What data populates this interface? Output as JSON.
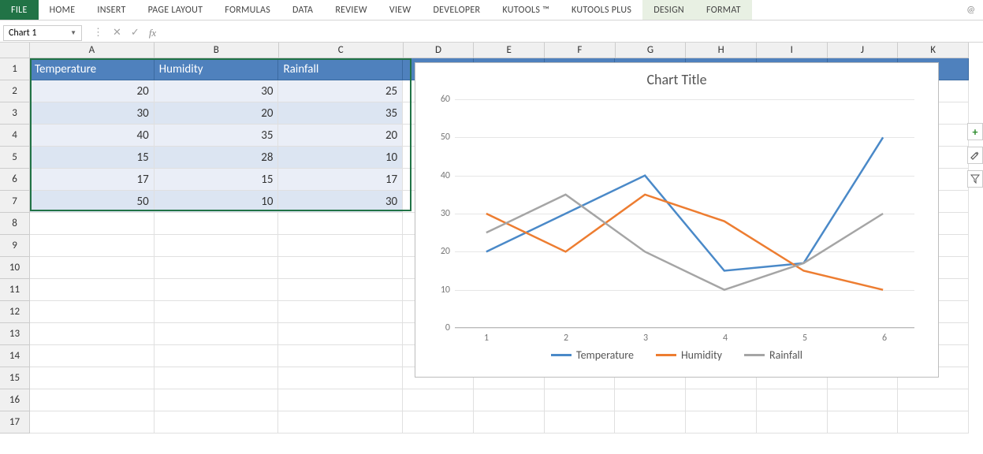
{
  "ribbon": {
    "tabs": [
      "FILE",
      "HOME",
      "INSERT",
      "PAGE LAYOUT",
      "FORMULAS",
      "DATA",
      "REVIEW",
      "VIEW",
      "DEVELOPER",
      "KUTOOLS ™",
      "KUTOOLS PLUS",
      "DESIGN",
      "FORMAT"
    ],
    "user": "@"
  },
  "namebox": "Chart 1",
  "columns": [
    "A",
    "B",
    "C",
    "D",
    "E",
    "F",
    "G",
    "H",
    "I",
    "J",
    "K"
  ],
  "rows": [
    "1",
    "2",
    "3",
    "4",
    "5",
    "6",
    "7",
    "8",
    "9",
    "10",
    "11",
    "12",
    "13",
    "14",
    "15",
    "16",
    "17"
  ],
  "table": {
    "headers": [
      "Temperature",
      "Humidity",
      "Rainfall"
    ],
    "data": [
      [
        20,
        30,
        25
      ],
      [
        30,
        20,
        35
      ],
      [
        40,
        35,
        20
      ],
      [
        15,
        28,
        10
      ],
      [
        17,
        15,
        17
      ],
      [
        50,
        10,
        30
      ]
    ]
  },
  "chart_data": {
    "type": "line",
    "title": "Chart Title",
    "categories": [
      1,
      2,
      3,
      4,
      5,
      6
    ],
    "series": [
      {
        "name": "Temperature",
        "values": [
          20,
          30,
          40,
          15,
          17,
          50
        ],
        "color": "#4a89c8"
      },
      {
        "name": "Humidity",
        "values": [
          30,
          20,
          35,
          28,
          15,
          10
        ],
        "color": "#ed7d31"
      },
      {
        "name": "Rainfall",
        "values": [
          25,
          35,
          20,
          10,
          17,
          30
        ],
        "color": "#a5a5a5"
      }
    ],
    "ylim": [
      0,
      60
    ],
    "yticks": [
      0,
      10,
      20,
      30,
      40,
      50,
      60
    ],
    "xlabel": "",
    "ylabel": ""
  },
  "side_icons": [
    "+",
    "✎",
    "▾"
  ],
  "colWidths": {
    "data": 162,
    "rest": 92
  }
}
